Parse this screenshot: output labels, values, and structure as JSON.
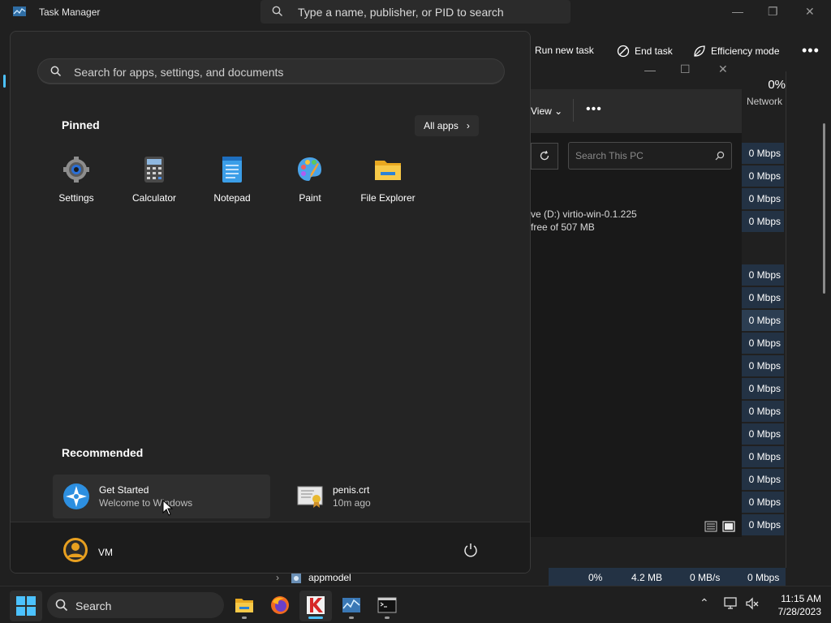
{
  "task_manager": {
    "title": "Task Manager",
    "search_placeholder": "Type a name, publisher, or PID to search",
    "toolbar": {
      "run_new_task": "Run new task",
      "end_task": "End task",
      "efficiency_mode": "Efficiency mode"
    },
    "network_header": {
      "percent": "0%",
      "label": "Network"
    },
    "network_values": [
      "0 Mbps",
      "0 Mbps",
      "0 Mbps",
      "0 Mbps",
      "0 Mbps",
      "0 Mbps",
      "0 Mbps",
      "0 Mbps",
      "0 Mbps",
      "0 Mbps",
      "0 Mbps",
      "0 Mbps",
      "0 Mbps",
      "0 Mbps",
      "0 Mbps",
      "0 Mbps",
      "0 Mbps"
    ],
    "bottom_row": {
      "name": "appmodel",
      "cpu": "0%",
      "memory": "4.2 MB",
      "disk": "0 MB/s",
      "network": "0 Mbps"
    }
  },
  "file_explorer": {
    "view_label": "View",
    "search_placeholder": "Search This PC",
    "drive_line1": "ve (D:) virtio-win-0.1.225",
    "drive_line2": "free of 507 MB"
  },
  "start_menu": {
    "search_placeholder": "Search for apps, settings, and documents",
    "pinned_title": "Pinned",
    "all_apps_label": "All apps",
    "pinned": [
      {
        "label": "Settings",
        "icon": "gear-icon"
      },
      {
        "label": "Calculator",
        "icon": "calculator-icon"
      },
      {
        "label": "Notepad",
        "icon": "notepad-icon"
      },
      {
        "label": "Paint",
        "icon": "paint-icon"
      },
      {
        "label": "File Explorer",
        "icon": "folder-icon"
      }
    ],
    "recommended_title": "Recommended",
    "recommended": [
      {
        "title": "Get Started",
        "subtitle": "Welcome to Windows",
        "icon": "get-started-icon"
      },
      {
        "title": "penis.crt",
        "subtitle": "10m ago",
        "icon": "certificate-icon"
      }
    ],
    "user": "VM"
  },
  "taskbar": {
    "search_label": "Search",
    "time": "11:15 AM",
    "date": "7/28/2023",
    "apps": [
      "file-explorer-icon",
      "firefox-icon",
      "kaspersky-icon",
      "task-manager-icon",
      "terminal-icon"
    ]
  },
  "colors": {
    "accent": "#4cc2ff",
    "highlight_cell": "#233244"
  }
}
